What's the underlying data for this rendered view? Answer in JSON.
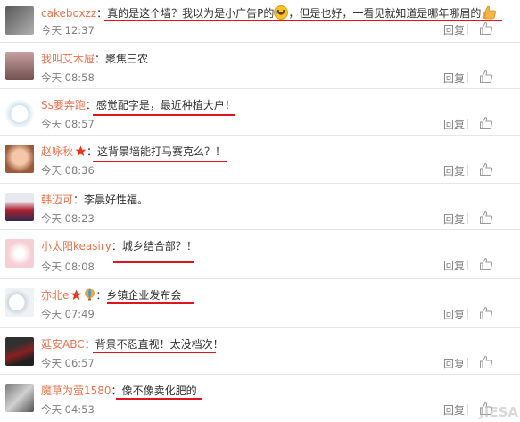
{
  "reply_label": "回复",
  "colors": {
    "username": "#eb7350",
    "underline": "#e0141e",
    "time": "#808080"
  },
  "comments": [
    {
      "user": "cakeboxzz",
      "text_before": "真的是这个墙？我以为是小广告P的",
      "text_after": "，但是也好，一看见就知道是哪年哪届的",
      "time": "今天 12:37",
      "icons": [
        "laugh-emoji",
        "thumbs-up-emoji"
      ]
    },
    {
      "user": "我叫艾木屉",
      "text": "聚焦三农",
      "time": "今天 08:58"
    },
    {
      "user": "Ss要奔跑",
      "text": "感觉配字是，最近种植大户！",
      "time": "今天 08:57"
    },
    {
      "user": "赵咏秋",
      "text": "这背景墙能打马赛克么？！",
      "time": "今天 08:36",
      "icons": [
        "red-star-badge"
      ]
    },
    {
      "user": "韩迈可",
      "text": "李晨好性福。",
      "time": "今天 08:23"
    },
    {
      "user": "小太阳keasiry",
      "text": "城乡结合部？！",
      "time": "今天 08:08"
    },
    {
      "user": "亦北e",
      "text": "乡镇企业发布会",
      "time": "今天 07:49",
      "icons": [
        "red-star-badge",
        "balloon-badge"
      ]
    },
    {
      "user": "延安ABC",
      "text": "背景不忍直视！太没档次！",
      "time": "今天 06:57"
    },
    {
      "user": "魔草为萤1580",
      "text": "像不像卖化肥的",
      "time": "今天 04:53"
    }
  ],
  "watermark": "JIESA"
}
